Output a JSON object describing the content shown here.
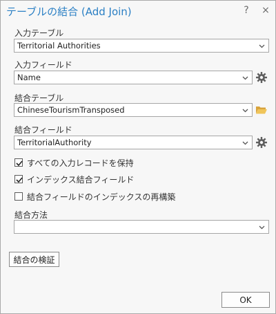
{
  "dialog": {
    "title": "テーブルの結合 (Add Join)",
    "help_glyph": "?",
    "close_glyph": "×"
  },
  "input_table": {
    "label": "入力テーブル",
    "value": "Territorial Authorities"
  },
  "input_field": {
    "label": "入力フィールド",
    "value": "Name"
  },
  "join_table": {
    "label": "結合テーブル",
    "value": "ChineseTourismTransposed"
  },
  "join_field": {
    "label": "結合フィールド",
    "value": "TerritorialAuthority"
  },
  "options": {
    "keep_all": {
      "label": "すべての入力レコードを保持",
      "checked": true
    },
    "index_join": {
      "label": "インデックス結合フィールド",
      "checked": true
    },
    "rebuild_index": {
      "label": "結合フィールドのインデックスの再構築",
      "checked": false
    }
  },
  "join_operation": {
    "label": "結合方法",
    "value": ""
  },
  "validate_button": "結合の検証",
  "ok_button": "OK",
  "icons": {
    "dropdown": "chevron-down-icon",
    "field_settings": "gear-icon",
    "browse": "folder-open-icon"
  },
  "colors": {
    "title": "#2a7fc4",
    "folder": "#e8b54a",
    "gear": "#5f5f5f"
  }
}
